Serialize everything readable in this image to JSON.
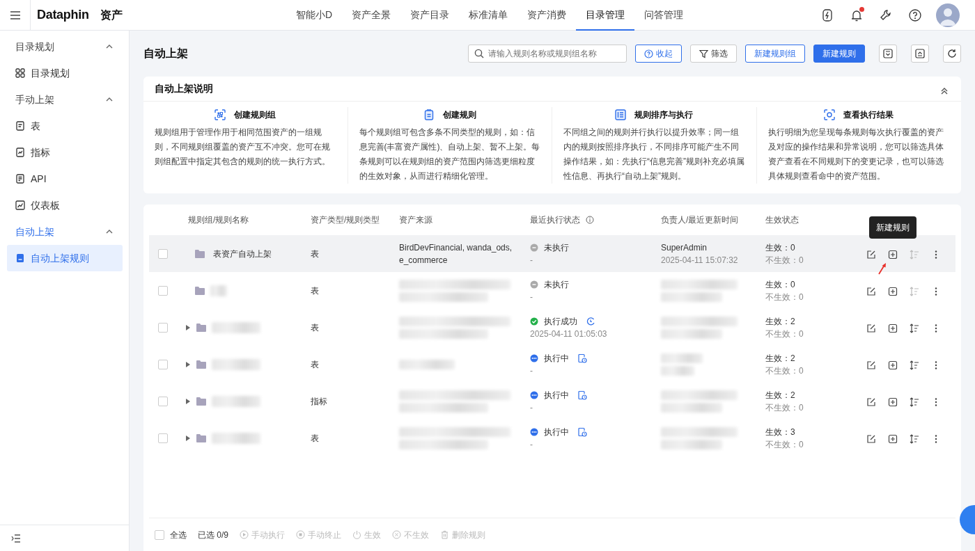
{
  "app": {
    "logo": "Dataphin",
    "product": "资产"
  },
  "nav_tabs": [
    {
      "label": "智能小D",
      "selected": false
    },
    {
      "label": "资产全景",
      "selected": false
    },
    {
      "label": "资产目录",
      "selected": false
    },
    {
      "label": "标准清单",
      "selected": false
    },
    {
      "label": "资产消费",
      "selected": false
    },
    {
      "label": "目录管理",
      "selected": true
    },
    {
      "label": "问答管理",
      "selected": false
    }
  ],
  "notifications": {
    "unread": true
  },
  "sidebar": {
    "groups": [
      {
        "label": "目录规划",
        "expanded": true,
        "children": [
          {
            "label": "目录规划",
            "selected": false
          }
        ]
      },
      {
        "label": "手动上架",
        "expanded": true,
        "children": [
          {
            "label": "表",
            "selected": false
          },
          {
            "label": "指标",
            "selected": false
          },
          {
            "label": "API",
            "selected": false
          },
          {
            "label": "仪表板",
            "selected": false
          }
        ]
      },
      {
        "label": "自动上架",
        "expanded": true,
        "children": [
          {
            "label": "自动上架规则",
            "selected": true
          }
        ]
      }
    ]
  },
  "page": {
    "title": "自动上架",
    "search": {
      "placeholder": "请输入规则名称或规则组名称"
    },
    "buttons": [
      {
        "label": "收起",
        "kind": "help-outline"
      },
      {
        "label": "筛选",
        "kind": "filter"
      },
      {
        "label": "新建规则组",
        "kind": "outline"
      },
      {
        "label": "新建规则",
        "kind": "primary"
      }
    ]
  },
  "explanation": {
    "title": "自动上架说明",
    "expanded": true,
    "sections": [
      {
        "title": "创建规则组",
        "text": "规则组用于管理作用于相同范围资产的一组规则，不同规则组覆盖的资产互不冲突。您可在规则组配置中指定其包含的规则的统一执行方式。"
      },
      {
        "title": "创建规则",
        "text": "每个规则组可包含多条不同类型的规则，如：信息完善(丰富资产属性)、自动上架、暂不上架。每条规则可以在规则组的资产范围内筛选更细粒度的生效对象，从而进行精细化管理。"
      },
      {
        "title": "规则排序与执行",
        "text": "不同组之间的规则并行执行以提升效率；同一组内的规则按照排序执行，不同排序可能产生不同操作结果，如：先执行“信息完善”规则补充必填属性信息、再执行“自动上架”规则。"
      },
      {
        "title": "查看执行结果",
        "text": "执行明细为您呈现每条规则每次执行覆盖的资产及对应的操作结果和异常说明，您可以筛选具体资产查看在不同规则下的变更记录，也可以筛选具体规则查看命中的资产范围。"
      }
    ]
  },
  "table": {
    "columns": [
      "规则组/规则名称",
      "资产类型/规则类型",
      "资产来源",
      "最近执行状态",
      "负责人/最近更新时间",
      "生效状态"
    ],
    "rows": [
      {
        "checked": false,
        "hovered": true,
        "expandable": false,
        "name": "表资产自动上架",
        "type": "表",
        "source": "BirdDevFinancial, wanda_ods, e_commerce",
        "status": {
          "kind": "idle",
          "label": "未执行",
          "time": "-"
        },
        "owner": "SuperAdmin",
        "updated": "2025-04-11 15:07:32",
        "effective": "生效：0",
        "ineffective": "不生效：0",
        "sort_enabled": false,
        "tooltip": "新建规则"
      },
      {
        "checked": false,
        "hovered": false,
        "expandable": false,
        "type": "表",
        "status": {
          "kind": "idle",
          "label": "未执行",
          "time": "-"
        },
        "effective": "生效：0",
        "ineffective": "不生效：0",
        "sort_enabled": false
      },
      {
        "checked": false,
        "hovered": false,
        "expandable": true,
        "type": "表",
        "status": {
          "kind": "success",
          "label": "执行成功",
          "time": "2025-04-11 01:05:03"
        },
        "effective": "生效：2",
        "ineffective": "不生效：0",
        "sort_enabled": true
      },
      {
        "checked": false,
        "hovered": false,
        "expandable": true,
        "type": "表",
        "status": {
          "kind": "running",
          "label": "执行中",
          "time": "-"
        },
        "effective": "生效：2",
        "ineffective": "不生效：0",
        "sort_enabled": true
      },
      {
        "checked": false,
        "hovered": false,
        "expandable": true,
        "type": "指标",
        "status": {
          "kind": "running",
          "label": "执行中",
          "time": "-"
        },
        "effective": "生效：2",
        "ineffective": "不生效：0",
        "sort_enabled": true
      },
      {
        "checked": false,
        "hovered": false,
        "expandable": true,
        "type": "表",
        "status": {
          "kind": "running",
          "label": "执行中",
          "time": "-"
        },
        "effective": "生效：3",
        "ineffective": "不生效：0",
        "sort_enabled": true
      }
    ]
  },
  "footer": {
    "select_all": {
      "label": "全选",
      "checked": false
    },
    "selected_count": "已选 0/9",
    "actions": [
      {
        "label": "手动执行",
        "disabled": true
      },
      {
        "label": "手动终止",
        "disabled": true
      },
      {
        "label": "生效",
        "disabled": true
      },
      {
        "label": "不生效",
        "disabled": true
      },
      {
        "label": "删除规则",
        "disabled": true
      }
    ]
  }
}
